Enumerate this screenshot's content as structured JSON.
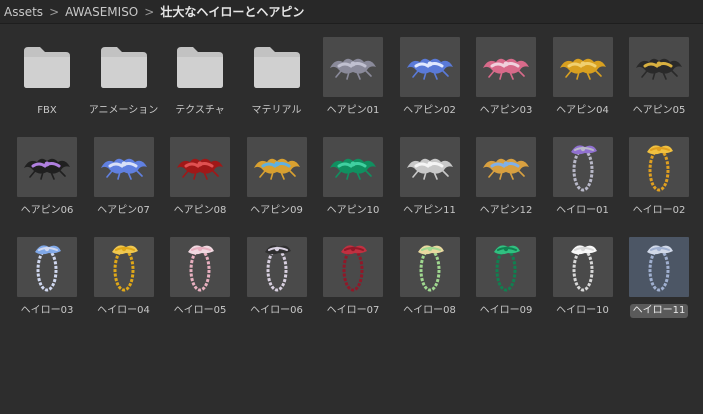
{
  "breadcrumb": {
    "items": [
      "Assets",
      "AWASEMISO",
      "壮大なヘイローとヘアピン"
    ],
    "separator": ">"
  },
  "colors": {
    "background": "#2d2d2d",
    "breadcrumb_bg": "#282828",
    "thumb_bg": "#4a4a4a",
    "selected_thumb_bg": "#4c5665",
    "folder_color": "#c2c2c2"
  },
  "assets": [
    {
      "label": "FBX",
      "kind": "folder",
      "icon": "folder-icon"
    },
    {
      "label": "アニメーション",
      "kind": "folder",
      "icon": "folder-icon"
    },
    {
      "label": "テクスチャ",
      "kind": "folder",
      "icon": "folder-icon"
    },
    {
      "label": "マテリアル",
      "kind": "folder",
      "icon": "folder-icon"
    },
    {
      "label": "ヘアピン01",
      "kind": "hairpin",
      "icon": "hairpin-icon",
      "color": "#8a8a9a",
      "accent": "#c0c0d0"
    },
    {
      "label": "ヘアピン02",
      "kind": "hairpin",
      "icon": "hairpin-icon",
      "color": "#5a7ad8",
      "accent": "#e0e8ff"
    },
    {
      "label": "ヘアピン03",
      "kind": "hairpin",
      "icon": "hairpin-icon",
      "color": "#d86a8a",
      "accent": "#f0d0dc"
    },
    {
      "label": "ヘアピン04",
      "kind": "hairpin",
      "icon": "hairpin-icon",
      "color": "#d8a020",
      "accent": "#f0d070"
    },
    {
      "label": "ヘアピン05",
      "kind": "hairpin",
      "icon": "hairpin-icon",
      "color": "#2a2a2a",
      "accent": "#d8b040"
    },
    {
      "label": "ヘアピン06",
      "kind": "hairpin",
      "icon": "hairpin-icon",
      "color": "#202020",
      "accent": "#b080e0"
    },
    {
      "label": "ヘアピン07",
      "kind": "hairpin",
      "icon": "hairpin-icon",
      "color": "#6080e0",
      "accent": "#d8e0f8"
    },
    {
      "label": "ヘアピン08",
      "kind": "hairpin",
      "icon": "hairpin-icon",
      "color": "#a01818",
      "accent": "#e05050"
    },
    {
      "label": "ヘアピン09",
      "kind": "hairpin",
      "icon": "hairpin-icon",
      "color": "#d8a030",
      "accent": "#60b0e0"
    },
    {
      "label": "ヘアピン10",
      "kind": "hairpin",
      "icon": "hairpin-icon",
      "color": "#109060",
      "accent": "#40d0a0"
    },
    {
      "label": "ヘアピン11",
      "kind": "hairpin",
      "icon": "hairpin-icon",
      "color": "#c8c8c8",
      "accent": "#f4f4f4"
    },
    {
      "label": "ヘアピン12",
      "kind": "hairpin",
      "icon": "hairpin-icon",
      "color": "#d8a040",
      "accent": "#80b0e8"
    },
    {
      "label": "ヘイロー01",
      "kind": "halo",
      "icon": "halo-icon",
      "color": "#b8b8c8",
      "accent": "#9070d0"
    },
    {
      "label": "ヘイロー02",
      "kind": "halo",
      "icon": "halo-icon",
      "color": "#e0a020",
      "accent": "#f0c040"
    },
    {
      "label": "ヘイロー03",
      "kind": "halo",
      "icon": "halo-icon",
      "color": "#d0d8f0",
      "accent": "#80a8e8"
    },
    {
      "label": "ヘイロー04",
      "kind": "halo",
      "icon": "halo-icon",
      "color": "#e0a818",
      "accent": "#f0c850"
    },
    {
      "label": "ヘイロー05",
      "kind": "halo",
      "icon": "halo-icon",
      "color": "#e8b0c0",
      "accent": "#f0d8e0"
    },
    {
      "label": "ヘイロー06",
      "kind": "halo",
      "icon": "halo-icon",
      "color": "#d8d0e0",
      "accent": "#303030"
    },
    {
      "label": "ヘイロー07",
      "kind": "halo",
      "icon": "halo-icon",
      "color": "#901828",
      "accent": "#c03040"
    },
    {
      "label": "ヘイロー08",
      "kind": "halo",
      "icon": "halo-icon",
      "color": "#a0d890",
      "accent": "#e8d8a0"
    },
    {
      "label": "ヘイロー09",
      "kind": "halo",
      "icon": "halo-icon",
      "color": "#108050",
      "accent": "#30c080"
    },
    {
      "label": "ヘイロー10",
      "kind": "halo",
      "icon": "halo-icon",
      "color": "#d8d8d8",
      "accent": "#f8f8f8"
    },
    {
      "label": "ヘイロー11",
      "kind": "halo",
      "icon": "halo-icon",
      "color": "#a0b0d0",
      "accent": "#d0d8e8",
      "selected": true
    }
  ]
}
